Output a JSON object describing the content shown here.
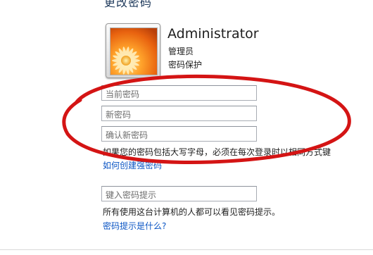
{
  "header": {
    "title_partial": "更改密码"
  },
  "account": {
    "name": "Administrator",
    "role": "管理员",
    "status": "密码保护"
  },
  "form": {
    "current_password_placeholder": "当前密码",
    "new_password_placeholder": "新密码",
    "confirm_password_placeholder": "确认新密码",
    "caps_note": "如果您的密码包括大写字母，必须在每次登录时以相同方式键",
    "create_strong_link": "如何创建强密码",
    "hint_placeholder": "键入密码提示",
    "hint_visible_note": "所有使用这台计算机的人都可以看见密码提示。",
    "hint_help_link": "密码提示是什么?"
  },
  "icons": {
    "avatar": "orange-flower-avatar"
  },
  "colors": {
    "annotation_ellipse": "#d41414",
    "link": "#0b55c4"
  }
}
